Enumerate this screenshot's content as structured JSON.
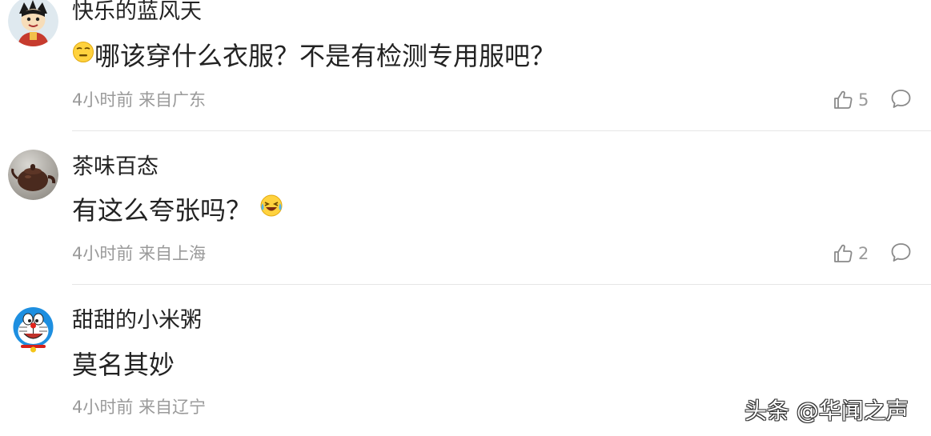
{
  "comments": [
    {
      "username": "快乐的蓝风天",
      "text": "哪该穿什么衣服？不是有检测专用服吧？",
      "time": "4小时前",
      "location": "来自广东",
      "likes": "5",
      "emoji_icon": "speechless-face-icon"
    },
    {
      "username": "茶味百态",
      "text": "有这么夸张吗？",
      "time": "4小时前",
      "location": "来自上海",
      "likes": "2",
      "emoji_icon": "laughing-tears-face-icon"
    },
    {
      "username": "甜甜的小米粥",
      "text": "莫名其妙",
      "time": "4小时前",
      "location": "来自辽宁"
    }
  ],
  "watermark": "头条 @华闻之声",
  "colors": {
    "text": "#222222",
    "meta": "#9a9a9a",
    "divider": "#e6e6e6"
  }
}
